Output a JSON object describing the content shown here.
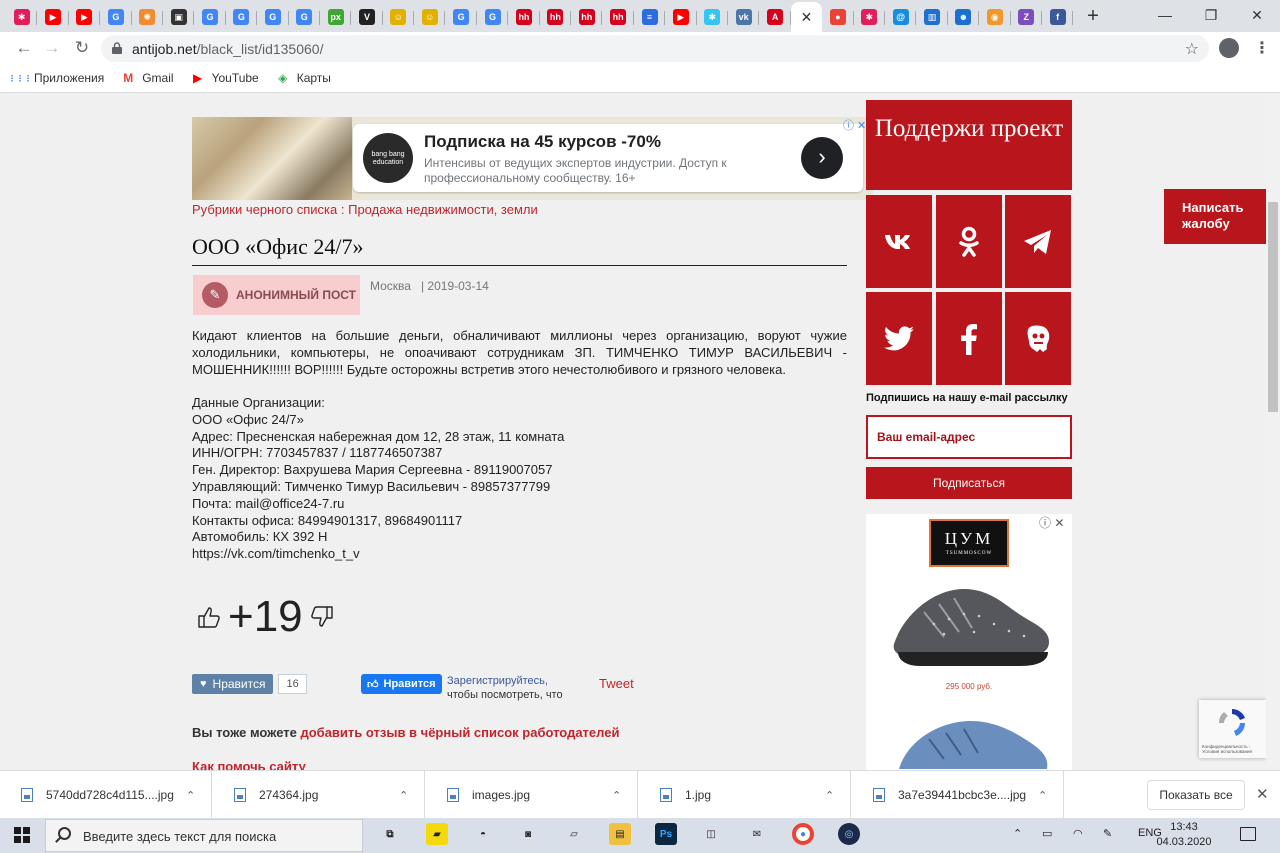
{
  "browser": {
    "tabs": [
      {
        "icon": "slack-icon",
        "color": "#e01e5a",
        "glyph": "✱"
      },
      {
        "icon": "youtube-icon",
        "color": "#ff0000",
        "glyph": "▶"
      },
      {
        "icon": "youtube-icon",
        "color": "#ff0000",
        "glyph": "▶"
      },
      {
        "icon": "google-icon",
        "color": "#4285f4",
        "glyph": "G"
      },
      {
        "icon": "pinwheel-icon",
        "color": "#f28b30",
        "glyph": "✺"
      },
      {
        "icon": "picture-icon",
        "color": "#333333",
        "glyph": "▣"
      },
      {
        "icon": "google-icon",
        "color": "#4285f4",
        "glyph": "G"
      },
      {
        "icon": "google-icon",
        "color": "#4285f4",
        "glyph": "G"
      },
      {
        "icon": "google-icon",
        "color": "#4285f4",
        "glyph": "G"
      },
      {
        "icon": "google-icon",
        "color": "#4285f4",
        "glyph": "G"
      },
      {
        "icon": "px-icon",
        "color": "#3fa535",
        "glyph": "px"
      },
      {
        "icon": "v-icon",
        "color": "#222222",
        "glyph": "V"
      },
      {
        "icon": "bulb-icon",
        "color": "#e2b100",
        "glyph": "☺"
      },
      {
        "icon": "bulb-icon",
        "color": "#e2b100",
        "glyph": "☺"
      },
      {
        "icon": "google-icon",
        "color": "#4285f4",
        "glyph": "G"
      },
      {
        "icon": "google-icon",
        "color": "#4285f4",
        "glyph": "G"
      },
      {
        "icon": "hh-icon",
        "color": "#d6001c",
        "glyph": "hh"
      },
      {
        "icon": "hh-icon",
        "color": "#d6001c",
        "glyph": "hh"
      },
      {
        "icon": "hh-icon",
        "color": "#d6001c",
        "glyph": "hh"
      },
      {
        "icon": "hh-icon",
        "color": "#d6001c",
        "glyph": "hh"
      },
      {
        "icon": "stripes-icon",
        "color": "#2d6cdf",
        "glyph": "≡"
      },
      {
        "icon": "youtube-icon",
        "color": "#ff0000",
        "glyph": "▶"
      },
      {
        "icon": "slack-icon",
        "color": "#36c5f0",
        "glyph": "✱"
      },
      {
        "icon": "vk-icon",
        "color": "#4a76a8",
        "glyph": "vk"
      },
      {
        "icon": "a-icon",
        "color": "#d6001c",
        "glyph": "A"
      },
      {
        "icon": "close-icon",
        "color": "#ffffff",
        "glyph": "✕"
      },
      {
        "icon": "map-pin-icon",
        "color": "#ea4335",
        "glyph": "●"
      },
      {
        "icon": "slack-icon",
        "color": "#e01e5a",
        "glyph": "✱"
      },
      {
        "icon": "mail-ru-icon",
        "color": "#168de2",
        "glyph": "@"
      },
      {
        "icon": "chart-icon",
        "color": "#1e6fd0",
        "glyph": "▥"
      },
      {
        "icon": "person-icon",
        "color": "#1c6fd0",
        "glyph": "☻"
      },
      {
        "icon": "chat-icon",
        "color": "#f2982a",
        "glyph": "◉"
      },
      {
        "icon": "z-icon",
        "color": "#7c4dbf",
        "glyph": "Z"
      },
      {
        "icon": "facebook-icon",
        "color": "#3b5998",
        "glyph": "f"
      }
    ],
    "active_tab_index": 25,
    "new_tab": "+",
    "window_controls": {
      "minimize": "—",
      "restore": "❐",
      "close": "✕"
    },
    "url_domain": "antijob.net",
    "url_path": "/black_list/id135060/",
    "bookmarks": [
      {
        "icon": "apps-icon",
        "label": "Приложения",
        "color": "#4285f4"
      },
      {
        "icon": "gmail-icon",
        "label": "Gmail",
        "color": "#ea4335"
      },
      {
        "icon": "youtube-icon",
        "label": "YouTube",
        "color": "#ff0000"
      },
      {
        "icon": "maps-icon",
        "label": "Карты",
        "color": "#34a853"
      }
    ]
  },
  "ad": {
    "title": "Подписка на 45 курсов -70%",
    "description": "Интенсивы от ведущих экспертов индустрии. Доступ к профессиональному сообществу. 16+",
    "logo_text": "bang bang education",
    "go": "›",
    "close": "ⓘ ✕"
  },
  "post": {
    "rubric_prefix": "Рубрики черного списка : ",
    "rubric": "Продажа недвижимости, земли",
    "title": "ООО «Офис 24/7»",
    "badge": "АНОНИМНЫЙ ПОСТ",
    "city": "Москва",
    "date": "| 2019-03-14",
    "body": "Кидают клиентов на большие деньги, обналичивают миллионы через организацию, воруют чужие холодильники, компьютеры, не опоачивают сотрудникам ЗП. ТИМЧЕНКО ТИМУР ВАСИЛЬЕВИЧ - МОШЕННИК!!!!!! ВОР!!!!!! Будьте осторожны встретив этого нечестолюбивого и грязного человека.",
    "org_lines": [
      "Данные Организации:",
      "ООО «Офис 24/7»",
      "Адрес: Пресненская набережная дом 12, 28 этаж, 11 комната",
      "ИНН/ОГРН: 7703457837 / 1187746507387",
      "Ген. Директор: Вахрушева Мария Сергеевна - 89119007057",
      "Управляющий: Тимченко Тимур Васильевич - 89857377799",
      "Почта: mail@office24-7.ru",
      "Контакты офиса: 84994901317, 89684901117",
      "Автомобиль: КХ 392 Н",
      "https://vk.com/timchenko_t_v"
    ],
    "rating": "+19",
    "vk_like": "Нравится",
    "vk_count": "16",
    "fb_like": "Нравится",
    "fb_register": "Зарегистрируйтесь,",
    "fb_rest": "чтобы посмотреть, что",
    "tweet": "Tweet",
    "cta_prefix": "Вы тоже можете ",
    "cta_link": "добавить отзыв в чёрный список работодателей",
    "help_link": "Как помочь сайту"
  },
  "sidebar": {
    "support": "Поддержи проект",
    "subscribe_label": "Подпишись на нашу e-mail рассылку",
    "email_placeholder": "Ваш email-адрес",
    "subscribe_button": "Подписаться",
    "brand": "ЦУМ",
    "brand_sub": "TSUMMOSCOW",
    "price": "295 000 руб."
  },
  "complaint_button": "Написать жалобу",
  "recaptcha_text": "Конфиденциальность - Условия использования",
  "downloads": {
    "items": [
      "5740dd728c4d115....jpg",
      "274364.jpg",
      "images.jpg",
      "1.jpg",
      "3a7e39441bcbc3e....jpg"
    ],
    "show_all": "Показать все"
  },
  "taskbar": {
    "search_placeholder": "Введите здесь текст для поиска",
    "lang": "ENG",
    "time": "13:43",
    "date": "04.03.2020"
  },
  "colors": {
    "brand_red": "#b8161c",
    "link_red": "#c0252b"
  }
}
